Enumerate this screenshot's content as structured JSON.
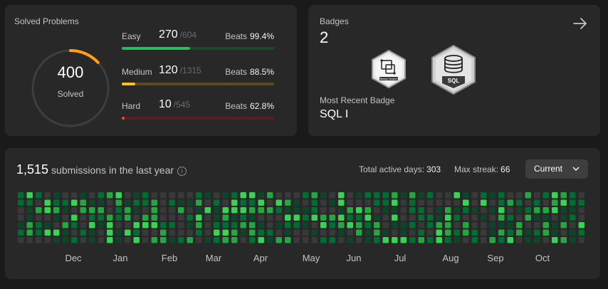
{
  "solved": {
    "title": "Solved Problems",
    "total": "400",
    "total_label": "Solved",
    "progress": 0.13,
    "rows": [
      {
        "name": "Easy",
        "count": "270",
        "total": "/604",
        "beats_label": "Beats",
        "beats": "99.4%",
        "fraction": 0.447,
        "color": "#2cbb5d",
        "track": "#1c4a2c",
        "name_color": "#c4c4c4"
      },
      {
        "name": "Medium",
        "count": "120",
        "total": "/1315",
        "beats_label": "Beats",
        "beats": "88.5%",
        "fraction": 0.091,
        "color": "#ffc01e",
        "track": "#5a4a1d",
        "name_color": "#c4c4c4"
      },
      {
        "name": "Hard",
        "count": "10",
        "total": "/545",
        "beats_label": "Beats",
        "beats": "62.8%",
        "fraction": 0.018,
        "color": "#ef4743",
        "track": "#5a1f23",
        "name_color": "#c4c4c4"
      }
    ]
  },
  "badges": {
    "title": "Badges",
    "count": "2",
    "items": [
      {
        "name": "binary-search-badge",
        "text": "Binary Search"
      },
      {
        "name": "sql-badge",
        "text": "SQL"
      }
    ],
    "recent_label": "Most Recent Badge",
    "recent": "SQL I"
  },
  "heatmap": {
    "count": "1,515",
    "title_rest": "submissions in the last year",
    "active_label": "Total active days:",
    "active": "303",
    "streak_label": "Max streak:",
    "streak": "66",
    "select_value": "Current",
    "months": [
      "Dec",
      "Jan",
      "Feb",
      "Mar",
      "Apr",
      "May",
      "Jun",
      "Jul",
      "Aug",
      "Sep",
      "Oct"
    ],
    "colors": [
      "#393939",
      "#0e4429",
      "#006d32",
      "#26a641",
      "#39d353"
    ]
  }
}
